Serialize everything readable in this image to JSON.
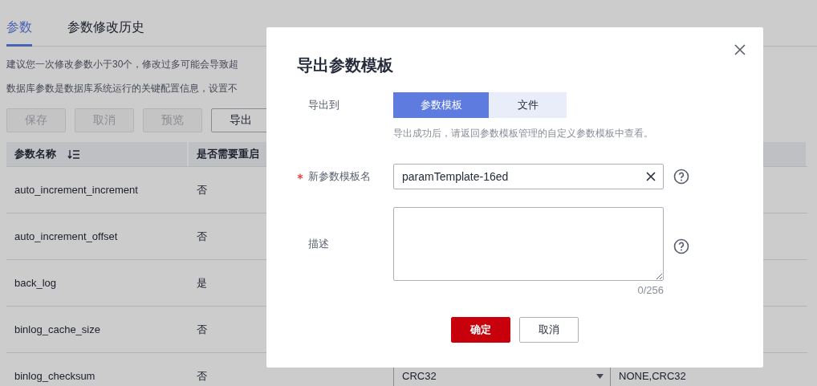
{
  "tabs": [
    {
      "label": "参数",
      "selected": true
    },
    {
      "label": "参数修改历史",
      "selected": false
    }
  ],
  "notices": [
    "建议您一次修改参数小于30个，修改过多可能会导致超",
    "数据库参数是数据库系统运行的关键配置信息，设置不"
  ],
  "toolbar": [
    {
      "label": "保存",
      "disabled": true
    },
    {
      "label": "取消",
      "disabled": true
    },
    {
      "label": "预览",
      "disabled": true
    },
    {
      "label": "导出",
      "disabled": false
    }
  ],
  "table": {
    "columns": [
      "参数名称",
      "是否需要重启"
    ],
    "rows": [
      {
        "name": "auto_increment_increment",
        "restart": "否"
      },
      {
        "name": "auto_increment_offset",
        "restart": "否"
      },
      {
        "name": "back_log",
        "restart": "是"
      },
      {
        "name": "binlog_cache_size",
        "restart": "否"
      },
      {
        "name": "binlog_checksum",
        "restart": "否",
        "value": "CRC32",
        "allowed": "NONE,CRC32"
      }
    ]
  },
  "dialog": {
    "title": "导出参数模板",
    "export_to": {
      "label": "导出到",
      "options": [
        {
          "label": "参数模板",
          "selected": true
        },
        {
          "label": "文件",
          "selected": false
        }
      ],
      "hint": "导出成功后，请返回参数模板管理的自定义参数模板中查看。"
    },
    "name_field": {
      "label": "新参数模板名",
      "required": true,
      "value": "paramTemplate-16ed"
    },
    "description": {
      "label": "描述",
      "counter": "0/256"
    },
    "buttons": [
      {
        "label": "确定",
        "kind": "primary"
      },
      {
        "label": "取消",
        "kind": "secondary"
      }
    ]
  }
}
